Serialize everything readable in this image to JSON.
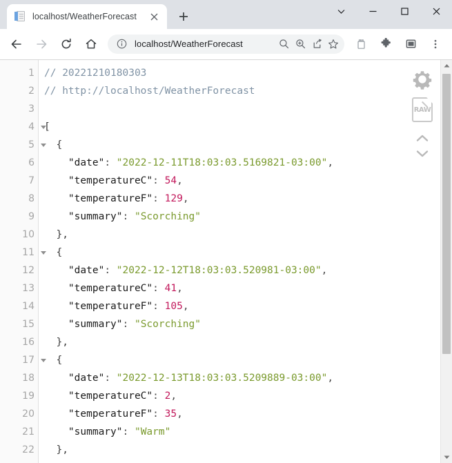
{
  "window": {
    "controls": [
      {
        "name": "tab-search",
        "glyph": "chevron-down"
      },
      {
        "name": "minimize",
        "glyph": "minimize"
      },
      {
        "name": "maximize",
        "glyph": "maximize"
      },
      {
        "name": "close",
        "glyph": "close"
      }
    ]
  },
  "tab": {
    "title": "localhost/WeatherForecast",
    "favicon": "page-icon",
    "close_label": "✕",
    "newtab_label": "+"
  },
  "toolbar": {
    "back_label": "←",
    "forward_label": "→",
    "reload_label": "↻",
    "home_label": "⌂",
    "url": "localhost/WeatherForecast",
    "site_info_icon": "info-circle-icon",
    "omnibox_icons": [
      "search-icon",
      "zoom-in-icon",
      "share-icon",
      "bookmark-star-icon"
    ],
    "right_icons": [
      "clipboard-icon",
      "extensions-puzzle-icon",
      "side-panel-icon",
      "more-menu-icon"
    ]
  },
  "viewer": {
    "tools": {
      "settings_label": "gear-icon",
      "raw_label": "RAW",
      "scroll_up_label": "chevron-up",
      "scroll_down_label": "chevron-down"
    },
    "lines": [
      {
        "n": "1",
        "fold": false,
        "tokens": [
          {
            "t": "cmt",
            "v": "// 20221210180303"
          }
        ]
      },
      {
        "n": "2",
        "fold": false,
        "tokens": [
          {
            "t": "cmt",
            "v": "// http://localhost/WeatherForecast"
          }
        ]
      },
      {
        "n": "3",
        "fold": false,
        "tokens": [
          {
            "t": "punc",
            "v": ""
          }
        ]
      },
      {
        "n": "4",
        "fold": true,
        "tokens": [
          {
            "t": "brace",
            "v": "["
          }
        ]
      },
      {
        "n": "5",
        "fold": true,
        "tokens": [
          {
            "t": "brace",
            "v": "  {"
          }
        ]
      },
      {
        "n": "6",
        "fold": false,
        "tokens": [
          {
            "t": "key",
            "v": "    \"date\""
          },
          {
            "t": "punc",
            "v": ": "
          },
          {
            "t": "str",
            "v": "\"2022-12-11T18:03:03.5169821-03:00\""
          },
          {
            "t": "punc",
            "v": ","
          }
        ]
      },
      {
        "n": "7",
        "fold": false,
        "tokens": [
          {
            "t": "key",
            "v": "    \"temperatureC\""
          },
          {
            "t": "punc",
            "v": ": "
          },
          {
            "t": "num",
            "v": "54"
          },
          {
            "t": "punc",
            "v": ","
          }
        ]
      },
      {
        "n": "8",
        "fold": false,
        "tokens": [
          {
            "t": "key",
            "v": "    \"temperatureF\""
          },
          {
            "t": "punc",
            "v": ": "
          },
          {
            "t": "num",
            "v": "129"
          },
          {
            "t": "punc",
            "v": ","
          }
        ]
      },
      {
        "n": "9",
        "fold": false,
        "tokens": [
          {
            "t": "key",
            "v": "    \"summary\""
          },
          {
            "t": "punc",
            "v": ": "
          },
          {
            "t": "str",
            "v": "\"Scorching\""
          }
        ]
      },
      {
        "n": "10",
        "fold": false,
        "tokens": [
          {
            "t": "brace",
            "v": "  },"
          }
        ]
      },
      {
        "n": "11",
        "fold": true,
        "tokens": [
          {
            "t": "brace",
            "v": "  {"
          }
        ]
      },
      {
        "n": "12",
        "fold": false,
        "tokens": [
          {
            "t": "key",
            "v": "    \"date\""
          },
          {
            "t": "punc",
            "v": ": "
          },
          {
            "t": "str",
            "v": "\"2022-12-12T18:03:03.520981-03:00\""
          },
          {
            "t": "punc",
            "v": ","
          }
        ]
      },
      {
        "n": "13",
        "fold": false,
        "tokens": [
          {
            "t": "key",
            "v": "    \"temperatureC\""
          },
          {
            "t": "punc",
            "v": ": "
          },
          {
            "t": "num",
            "v": "41"
          },
          {
            "t": "punc",
            "v": ","
          }
        ]
      },
      {
        "n": "14",
        "fold": false,
        "tokens": [
          {
            "t": "key",
            "v": "    \"temperatureF\""
          },
          {
            "t": "punc",
            "v": ": "
          },
          {
            "t": "num",
            "v": "105"
          },
          {
            "t": "punc",
            "v": ","
          }
        ]
      },
      {
        "n": "15",
        "fold": false,
        "tokens": [
          {
            "t": "key",
            "v": "    \"summary\""
          },
          {
            "t": "punc",
            "v": ": "
          },
          {
            "t": "str",
            "v": "\"Scorching\""
          }
        ]
      },
      {
        "n": "16",
        "fold": false,
        "tokens": [
          {
            "t": "brace",
            "v": "  },"
          }
        ]
      },
      {
        "n": "17",
        "fold": true,
        "tokens": [
          {
            "t": "brace",
            "v": "  {"
          }
        ]
      },
      {
        "n": "18",
        "fold": false,
        "tokens": [
          {
            "t": "key",
            "v": "    \"date\""
          },
          {
            "t": "punc",
            "v": ": "
          },
          {
            "t": "str",
            "v": "\"2022-12-13T18:03:03.5209889-03:00\""
          },
          {
            "t": "punc",
            "v": ","
          }
        ]
      },
      {
        "n": "19",
        "fold": false,
        "tokens": [
          {
            "t": "key",
            "v": "    \"temperatureC\""
          },
          {
            "t": "punc",
            "v": ": "
          },
          {
            "t": "num",
            "v": "2"
          },
          {
            "t": "punc",
            "v": ","
          }
        ]
      },
      {
        "n": "20",
        "fold": false,
        "tokens": [
          {
            "t": "key",
            "v": "    \"temperatureF\""
          },
          {
            "t": "punc",
            "v": ": "
          },
          {
            "t": "num",
            "v": "35"
          },
          {
            "t": "punc",
            "v": ","
          }
        ]
      },
      {
        "n": "21",
        "fold": false,
        "tokens": [
          {
            "t": "key",
            "v": "    \"summary\""
          },
          {
            "t": "punc",
            "v": ": "
          },
          {
            "t": "str",
            "v": "\"Warm\""
          }
        ]
      },
      {
        "n": "22",
        "fold": false,
        "tokens": [
          {
            "t": "brace",
            "v": "  },"
          }
        ]
      }
    ]
  },
  "colors": {
    "tabstrip": "#dee1e6",
    "omnibox": "#f1f3f4",
    "comment": "#8093a5",
    "string": "#7a9a2d",
    "number": "#c2185b",
    "key": "#1a1a1a",
    "gutter_text": "#a5a5a5",
    "scrollbar_thumb": "#c1c1c1"
  }
}
